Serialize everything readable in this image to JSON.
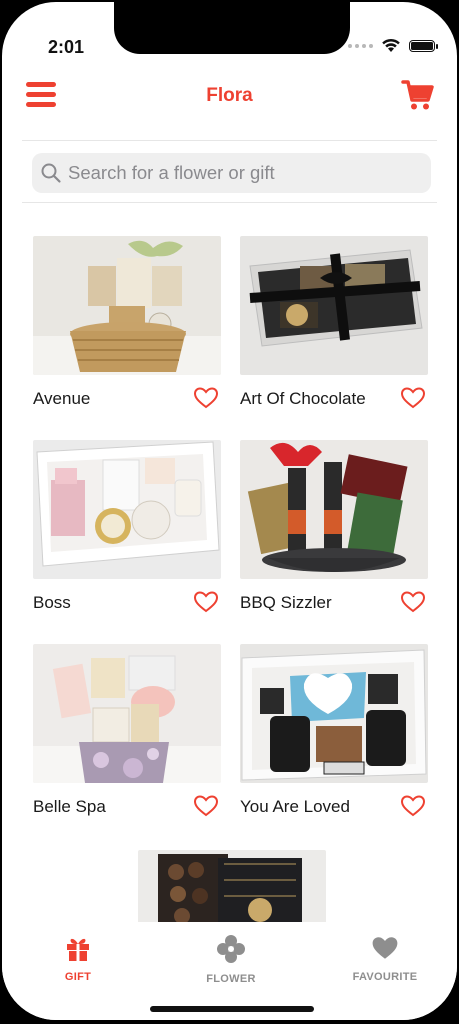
{
  "status": {
    "time": "2:01"
  },
  "header": {
    "title": "Flora"
  },
  "search": {
    "placeholder": "Search for a flower or gift"
  },
  "products": [
    {
      "name": "Avenue"
    },
    {
      "name": "Art Of Chocolate"
    },
    {
      "name": "Boss"
    },
    {
      "name": "BBQ Sizzler"
    },
    {
      "name": "Belle Spa"
    },
    {
      "name": "You Are Loved"
    }
  ],
  "tabs": [
    {
      "label": "GIFT",
      "icon": "gift-icon",
      "active": true
    },
    {
      "label": "FLOWER",
      "icon": "flower-icon",
      "active": false
    },
    {
      "label": "FAVOURITE",
      "icon": "heart-icon",
      "active": false
    }
  ],
  "colors": {
    "accent": "#ee4131",
    "inactive": "#8e8e8e"
  }
}
